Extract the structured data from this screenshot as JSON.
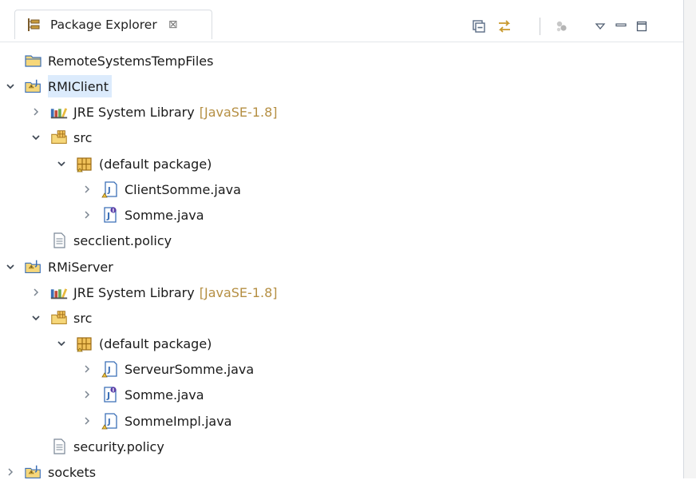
{
  "view": {
    "tab_title": "Package Explorer",
    "tab_close": "⊠"
  },
  "tree": [
    {
      "label": "RemoteSystemsTempFiles",
      "expanded": null,
      "icon": "folder-project-icon"
    },
    {
      "label": "RMIClient",
      "expanded": true,
      "icon": "java-project-icon",
      "selected": true
    },
    {
      "label": "JRE System Library",
      "decoration": "[JavaSE-1.8]",
      "expanded": false,
      "icon": "library-icon"
    },
    {
      "label": "src",
      "expanded": true,
      "icon": "source-folder-icon"
    },
    {
      "label": "(default package)",
      "expanded": true,
      "icon": "package-icon"
    },
    {
      "label": "ClientSomme.java",
      "expanded": false,
      "icon": "java-class-file-icon"
    },
    {
      "label": "Somme.java",
      "expanded": false,
      "icon": "java-interface-file-icon"
    },
    {
      "label": "secclient.policy",
      "expanded": null,
      "icon": "text-file-icon"
    },
    {
      "label": "RMiServer",
      "expanded": true,
      "icon": "java-project-icon"
    },
    {
      "label": "JRE System Library",
      "decoration": "[JavaSE-1.8]",
      "expanded": false,
      "icon": "library-icon"
    },
    {
      "label": "src",
      "expanded": true,
      "icon": "source-folder-icon"
    },
    {
      "label": "(default package)",
      "expanded": true,
      "icon": "package-icon"
    },
    {
      "label": "ServeurSomme.java",
      "expanded": false,
      "icon": "java-class-file-icon"
    },
    {
      "label": "Somme.java",
      "expanded": false,
      "icon": "java-interface-file-icon"
    },
    {
      "label": "SommeImpl.java",
      "expanded": false,
      "icon": "java-class-file-icon"
    },
    {
      "label": "security.policy",
      "expanded": null,
      "icon": "text-file-icon"
    },
    {
      "label": "sockets",
      "expanded": false,
      "icon": "java-project-icon"
    }
  ],
  "toolbar": [
    {
      "name": "collapse-all-icon"
    },
    {
      "name": "link-with-editor-icon"
    },
    {
      "name": "focus-on-active-task-icon"
    },
    {
      "name": "view-menu-icon"
    },
    {
      "name": "minimize-icon"
    },
    {
      "name": "maximize-icon"
    }
  ],
  "colors": {
    "selection": "#dcebfc",
    "decoration": "#b58f43",
    "folder": "#e8c35a",
    "java_blue": "#3b6fb6"
  }
}
